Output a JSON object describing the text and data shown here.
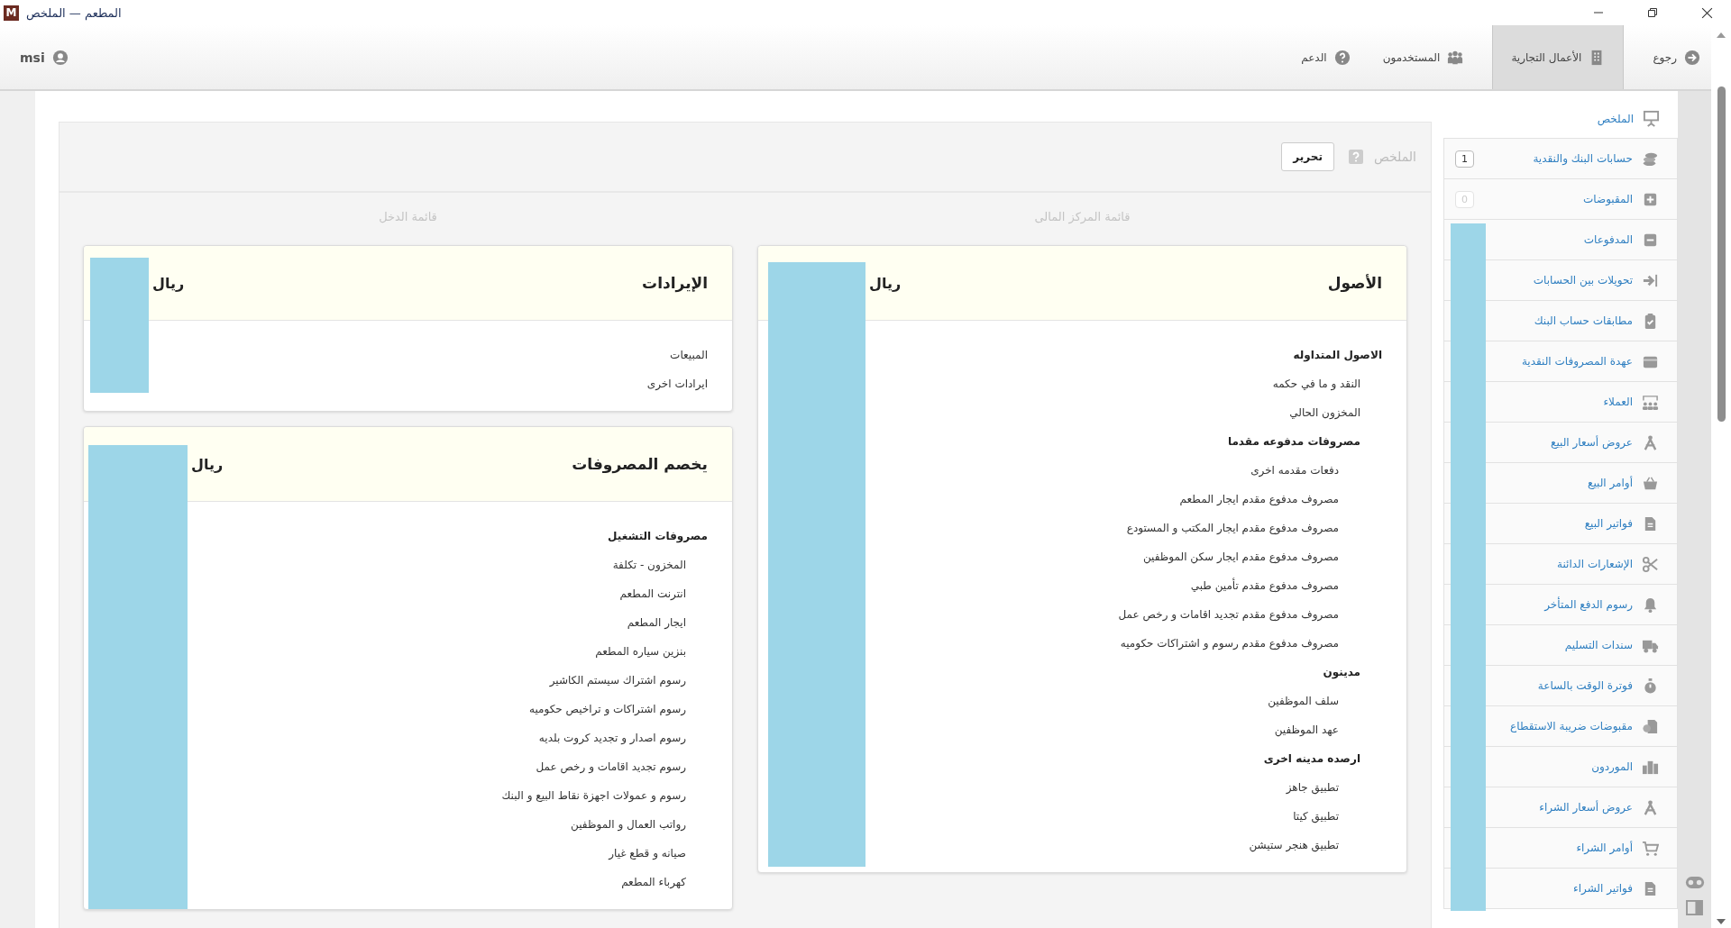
{
  "window": {
    "title": "المطعم — الملخص",
    "app_icon": "M"
  },
  "nav": {
    "tabs": [
      {
        "label": "رجوع",
        "selected": false
      },
      {
        "label": "الأعمال التجارية",
        "selected": true
      },
      {
        "label": "المستخدمون",
        "selected": false
      },
      {
        "label": "الدعم",
        "selected": false
      }
    ],
    "user": "msi"
  },
  "sidebar": {
    "items": [
      {
        "label": "الملخص",
        "selected": true
      },
      {
        "label": "حسابات البنك والنقدية",
        "selected": false,
        "badge": "1",
        "badge_dimmed": false
      },
      {
        "label": "المقبوضات",
        "selected": false,
        "badge": "0",
        "badge_dimmed": true
      },
      {
        "label": "المدفوعات",
        "selected": false
      },
      {
        "label": "تحويلات بين الحسابات",
        "selected": false
      },
      {
        "label": "مطابقات حساب البنك",
        "selected": false
      },
      {
        "label": "عهدة المصروفات النقدية",
        "selected": false
      },
      {
        "label": "العملاء",
        "selected": false
      },
      {
        "label": "عروض أسعار البيع",
        "selected": false
      },
      {
        "label": "أوامر البيع",
        "selected": false
      },
      {
        "label": "فواتير البيع",
        "selected": false
      },
      {
        "label": "الإشعارات الدائنة",
        "selected": false
      },
      {
        "label": "رسوم الدفع المتأخر",
        "selected": false
      },
      {
        "label": "سندات التسليم",
        "selected": false
      },
      {
        "label": "فوترة الوقت بالساعة",
        "selected": false
      },
      {
        "label": "مقبوضات ضريبة الاستقطاع",
        "selected": false
      },
      {
        "label": "الموردون",
        "selected": false
      },
      {
        "label": "عروض أسعار الشراء",
        "selected": false
      },
      {
        "label": "أوامر الشراء",
        "selected": false
      },
      {
        "label": "فواتير الشراء",
        "selected": false
      }
    ]
  },
  "panel": {
    "title": "الملخص",
    "edit_button": "تحرير",
    "columns": [
      {
        "title": "قائمة المركز المالى",
        "cards": [
          {
            "title": "الأصول",
            "currency": "ريال",
            "rows": [
              {
                "label": "الاصول المتداوله",
                "children": [
                  {
                    "label": "النقد و ما في حكمه"
                  },
                  {
                    "label": "المخزون الحالي"
                  },
                  {
                    "label": "مصروفات مدفوعه مقدما",
                    "children": [
                      {
                        "label": "دفعات مقدمه اخرى"
                      },
                      {
                        "label": "مصروف مدفوع مقدم ايجار المطعم"
                      },
                      {
                        "label": "مصروف مدفوع مقدم ايجار المكتب و المستودع"
                      },
                      {
                        "label": "مصروف مدفوع مقدم ايجار سكن الموظفين"
                      },
                      {
                        "label": "مصروف مدفوع مقدم تأمين طبي"
                      },
                      {
                        "label": "مصروف مدفوع مقدم تجديد اقامات و رخص عمل"
                      },
                      {
                        "label": "مصروف مدفوع مقدم رسوم و اشتراكات حكوميه"
                      }
                    ]
                  },
                  {
                    "label": "مدينون",
                    "children": [
                      {
                        "label": "سلف الموظفين"
                      },
                      {
                        "label": "عهد الموظفين"
                      }
                    ]
                  },
                  {
                    "label": "ارصده مدينه اخرى",
                    "children": [
                      {
                        "label": "تطبيق جاهز"
                      },
                      {
                        "label": "تطبيق كيتا"
                      },
                      {
                        "label": "تطبيق هنجر ستيشن"
                      }
                    ]
                  }
                ]
              }
            ]
          }
        ]
      },
      {
        "title": "قائمة الدخل",
        "cards": [
          {
            "title": "الإيرادات",
            "currency": "ريال",
            "rows": [
              {
                "label": "المبيعات"
              },
              {
                "label": "ايرادات اخرى"
              }
            ]
          },
          {
            "title": "يخصم المصروفات",
            "currency": "ريال",
            "rows": [
              {
                "label": "مصروفات التشغيل",
                "children": [
                  {
                    "label": "المخزون - تكلفة"
                  },
                  {
                    "label": "انترنت المطعم"
                  },
                  {
                    "label": "ايجار المطعم"
                  },
                  {
                    "label": "بنزين سياره المطعم"
                  },
                  {
                    "label": "رسوم اشتراك سيستم الكاشير"
                  },
                  {
                    "label": "رسوم اشتراكات و تراخيص حكوميه"
                  },
                  {
                    "label": "رسوم اصدار و تجديد كروت بلديه"
                  },
                  {
                    "label": "رسوم تجديد اقامات و رخص عمل"
                  },
                  {
                    "label": "رسوم و عمولات اجهزة نقاط البيع و البنك"
                  },
                  {
                    "label": "رواتب العمال و الموظفين"
                  },
                  {
                    "label": "صيانه و قطع غيار"
                  },
                  {
                    "label": "كهرباء المطعم"
                  }
                ]
              }
            ]
          }
        ]
      }
    ]
  }
}
